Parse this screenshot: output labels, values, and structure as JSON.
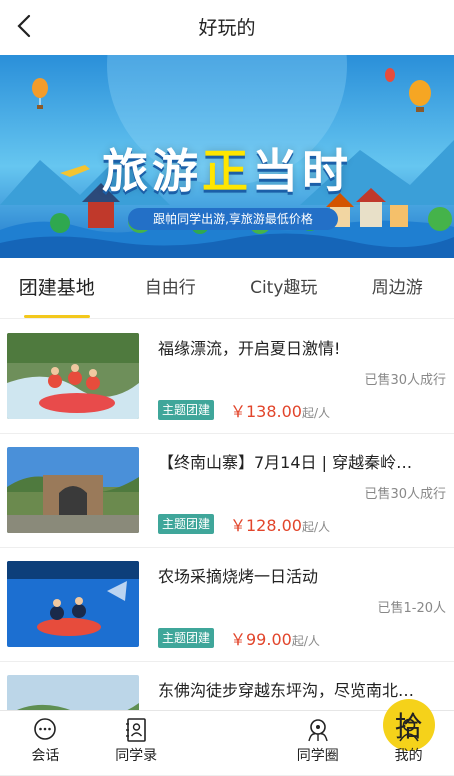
{
  "header": {
    "title": "好玩的"
  },
  "banner": {
    "title_part1": "旅游",
    "title_highlight": "正",
    "title_part2": "当时",
    "subtitle": "跟帕同学出游,享旅游最低价格",
    "dots_count": 5,
    "active_dot_index": 3
  },
  "tabs": [
    {
      "label": "团建基地",
      "active": true
    },
    {
      "label": "自由行",
      "active": false
    },
    {
      "label": "City趣玩",
      "active": false
    },
    {
      "label": "周边游",
      "active": false
    }
  ],
  "items": [
    {
      "title": "福缘漂流，开启夏日激情!",
      "sold": "已售30人成行",
      "tag": "主题团建",
      "price": "￥138.00",
      "unit": "起/人"
    },
    {
      "title": "【终南山寨】7月14日 | 穿越秦岭…",
      "sold": "已售30人成行",
      "tag": "主题团建",
      "price": "￥128.00",
      "unit": "起/人"
    },
    {
      "title": "农场采摘烧烤一日活动",
      "sold": "已售1-20人",
      "tag": "主题团建",
      "price": "￥99.00",
      "unit": "起/人"
    },
    {
      "title": "东佛沟徒步穿越东坪沟，尽览南北…",
      "sold": "",
      "tag": "",
      "price": "",
      "unit": ""
    }
  ],
  "tabbar": {
    "items": [
      {
        "label": "会话",
        "icon": "chat-icon"
      },
      {
        "label": "同学录",
        "icon": "contacts-icon"
      },
      {
        "label": "拾",
        "icon": "center-action"
      },
      {
        "label": "同学圈",
        "icon": "moments-icon"
      },
      {
        "label": "我的",
        "icon": "profile-icon"
      }
    ]
  }
}
